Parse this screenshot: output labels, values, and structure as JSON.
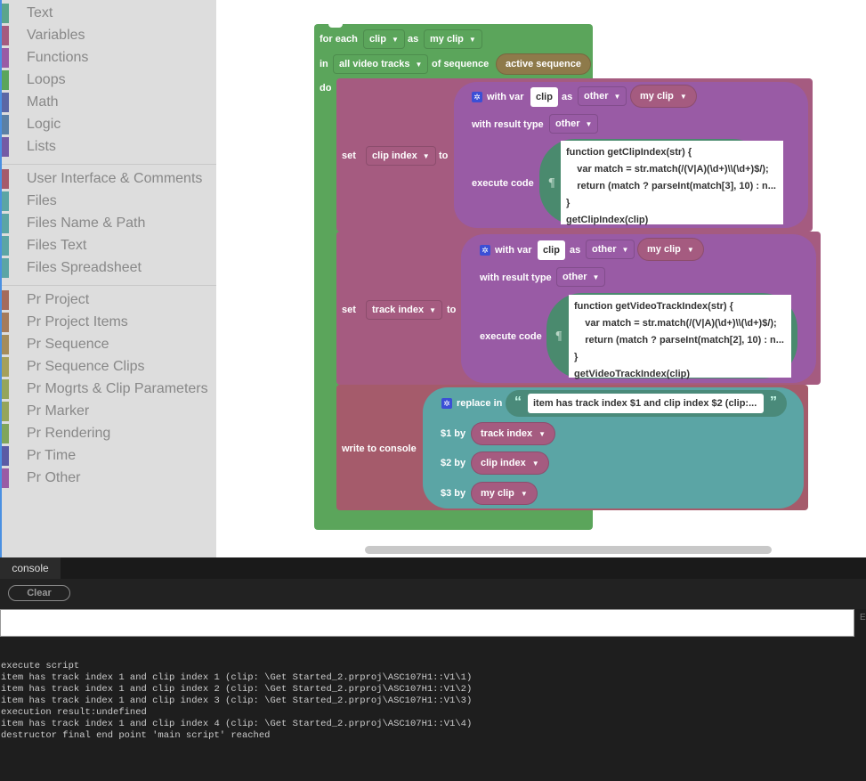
{
  "sidebar": {
    "categories": [
      {
        "label": "Text",
        "color": "#5ba58c"
      },
      {
        "label": "Variables",
        "color": "#a55b80"
      },
      {
        "label": "Functions",
        "color": "#995ba5"
      },
      {
        "label": "Loops",
        "color": "#5ba55b"
      },
      {
        "label": "Math",
        "color": "#5b67a5"
      },
      {
        "label": "Logic",
        "color": "#5b80a5"
      },
      {
        "label": "Lists",
        "color": "#745ba5"
      },
      {
        "label": "User Interface & Comments",
        "color": "#a55b6b"
      },
      {
        "label": "Files",
        "color": "#5ba5a5"
      },
      {
        "label": "Files Name & Path",
        "color": "#5ba5a5"
      },
      {
        "label": "Files Text",
        "color": "#5ba5a5"
      },
      {
        "label": "Files Spreadsheet",
        "color": "#5ba5a5"
      },
      {
        "label": "Pr Project",
        "color": "#a56b5b"
      },
      {
        "label": "Pr Project Items",
        "color": "#a57b5b"
      },
      {
        "label": "Pr Sequence",
        "color": "#a58c5b"
      },
      {
        "label": "Pr Sequence Clips",
        "color": "#a5a05b"
      },
      {
        "label": "Pr Mogrts & Clip Parameters",
        "color": "#95a55b"
      },
      {
        "label": "Pr Marker",
        "color": "#95a55b"
      },
      {
        "label": "Pr Rendering",
        "color": "#80a55b"
      },
      {
        "label": "Pr Time",
        "color": "#5b5ba5"
      },
      {
        "label": "Pr Other",
        "color": "#9a5ba5"
      }
    ]
  },
  "blocks": {
    "foreach": {
      "for_each": "for each",
      "item_type": "clip",
      "as": "as",
      "var": "my clip",
      "in": "in",
      "tracks": "all video tracks",
      "of_sequence": "of sequence",
      "sequence": "active sequence",
      "do": "do"
    },
    "set1": {
      "set": "set",
      "var": "clip index",
      "to": "to",
      "with_var": "with var",
      "clip": "clip",
      "as": "as",
      "type": "other",
      "value": "my clip",
      "result_label": "with result type",
      "result_type": "other",
      "execute": "execute code",
      "pilcrow": "¶",
      "code": "function getClipIndex(str) {\n    var match = str.match(/(V|A)(\\d+)\\\\(\\d+)$/);\n    return (match ? parseInt(match[3], 10) : n...\n}\ngetClipIndex(clip)"
    },
    "set2": {
      "set": "set",
      "var": "track index",
      "to": "to",
      "with_var": "with var",
      "clip": "clip",
      "as": "as",
      "type": "other",
      "value": "my clip",
      "result_label": "with result type",
      "result_type": "other",
      "execute": "execute code",
      "pilcrow": "¶",
      "code": "function getVideoTrackIndex(str) {\n    var match = str.match(/(V|A)(\\d+)\\\\(\\d+)$/);\n    return (match ? parseInt(match[2], 10) : n...\n}\ngetVideoTrackIndex(clip)"
    },
    "write": {
      "label": "write to console",
      "replace_in": "replace in",
      "open_quote": "“",
      "close_quote": "”",
      "text": "item has track index $1 and clip index $2 (clip:...",
      "by1": "$1 by",
      "v1": "track index",
      "by2": "$2 by",
      "v2": "clip index",
      "by3": "$3 by",
      "v3": "my clip"
    }
  },
  "console": {
    "tab": "console",
    "clear": "Clear",
    "input_value": "",
    "side_label": "E",
    "output": "execute script\nitem has track index 1 and clip index 1 (clip: \\Get Started_2.prproj\\ASC107H1::V1\\1)\nitem has track index 1 and clip index 2 (clip: \\Get Started_2.prproj\\ASC107H1::V1\\2)\nitem has track index 1 and clip index 3 (clip: \\Get Started_2.prproj\\ASC107H1::V1\\3)\nexecution result:undefined\nitem has track index 1 and clip index 4 (clip: \\Get Started_2.prproj\\ASC107H1::V1\\4)\ndestructor final end point 'main script' reached"
  }
}
